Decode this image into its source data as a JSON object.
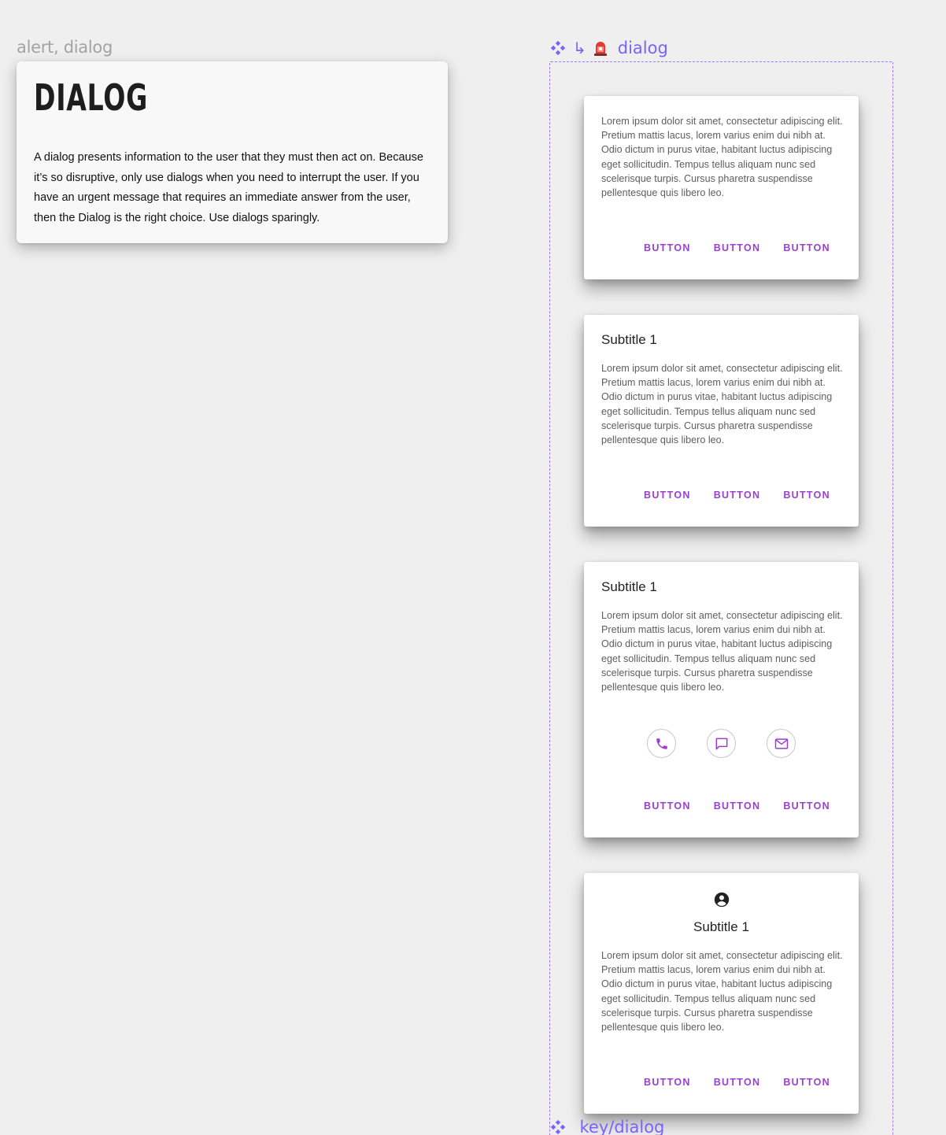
{
  "frame_label": "alert, dialog",
  "doc": {
    "title": "DIALOG",
    "description": "A dialog presents information to the user that they must then act on. Because it’s so disruptive, only use dialogs when you need to interrupt the user. If you have an urgent message that requires an immediate answer from the user, then the Dialog is the right choice. Use dialogs sparingly."
  },
  "component": {
    "name": "dialog",
    "footer_name": "_key/dialog",
    "accent_color": "#7b61ff"
  },
  "dialogs": [
    {
      "variant": "text-only",
      "subtitle": "",
      "body": "Lorem ipsum dolor sit amet, consectetur adipiscing elit. Pretium mattis lacus, lorem varius enim dui nibh at. Odio dictum in purus vitae, habitant luctus adipiscing eget sollicitudin. Tempus tellus aliquam nunc sed scelerisque turpis. Cursus pharetra suspendisse pellentesque quis libero leo.",
      "buttons": [
        "BUTTON",
        "BUTTON",
        "BUTTON"
      ]
    },
    {
      "variant": "with-title",
      "subtitle": "Subtitle 1",
      "body": "Lorem ipsum dolor sit amet, consectetur adipiscing elit. Pretium mattis lacus, lorem varius enim dui nibh at. Odio dictum in purus vitae, habitant luctus adipiscing eget sollicitudin. Tempus tellus aliquam nunc sed scelerisque turpis. Cursus pharetra suspendisse pellentesque quis libero leo.",
      "buttons": [
        "BUTTON",
        "BUTTON",
        "BUTTON"
      ]
    },
    {
      "variant": "with-icons",
      "subtitle": "Subtitle 1",
      "body": "Lorem ipsum dolor sit amet, consectetur adipiscing elit. Pretium mattis lacus, lorem varius enim dui nibh at. Odio dictum in purus vitae, habitant luctus adipiscing eget sollicitudin. Tempus tellus aliquam nunc sed scelerisque turpis. Cursus pharetra suspendisse pellentesque quis libero leo.",
      "icons": [
        "phone-icon",
        "chat-icon",
        "mail-icon"
      ],
      "buttons": [
        "BUTTON",
        "BUTTON",
        "BUTTON"
      ]
    },
    {
      "variant": "with-avatar",
      "icon": "account-circle-icon",
      "subtitle": "Subtitle 1",
      "body": "Lorem ipsum dolor sit amet, consectetur adipiscing elit. Pretium mattis lacus, lorem varius enim dui nibh at. Odio dictum in purus vitae, habitant luctus adipiscing eget sollicitudin. Tempus tellus aliquam nunc sed scelerisque turpis. Cursus pharetra suspendisse pellentesque quis libero leo.",
      "buttons": [
        "BUTTON",
        "BUTTON",
        "BUTTON"
      ]
    }
  ],
  "colors": {
    "background": "#efefef",
    "button_text": "#9b3fd0",
    "component_purple": "#7b61ff"
  }
}
